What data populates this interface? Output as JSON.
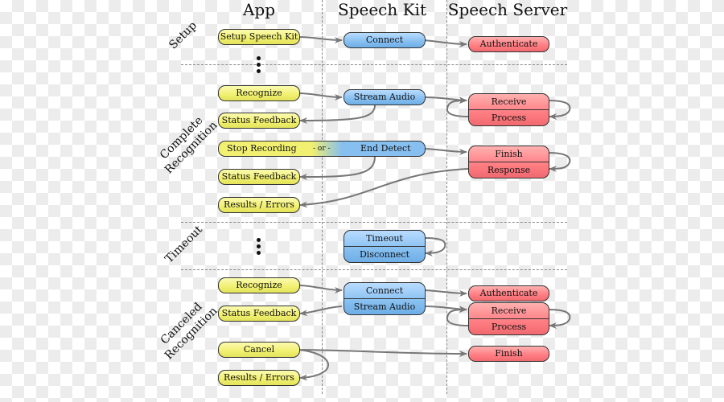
{
  "columns": {
    "app": "App",
    "speech_kit": "Speech Kit",
    "speech_server": "Speech Server"
  },
  "sections": {
    "setup": "Setup",
    "complete": [
      "Complete",
      "Recognition"
    ],
    "timeout": "Timeout",
    "canceled": [
      "Canceled",
      "Recognition"
    ]
  },
  "setup": {
    "app": "Setup Speech Kit",
    "kit": "Connect",
    "server": "Authenticate"
  },
  "complete": {
    "recognize": "Recognize",
    "stream_audio": "Stream Audio",
    "receive": "Receive",
    "process": "Process",
    "status_feedback_1": "Status Feedback",
    "stop_recording": "Stop Recording",
    "or": "- or -",
    "end_detect": "End Detect",
    "finish": "Finish",
    "response": "Response",
    "status_feedback_2": "Status Feedback",
    "results": "Results / Errors"
  },
  "timeout": {
    "timeout": "Timeout",
    "disconnect": "Disconnect"
  },
  "canceled": {
    "recognize": "Recognize",
    "connect": "Connect",
    "stream_audio": "Stream Audio",
    "authenticate": "Authenticate",
    "receive": "Receive",
    "process": "Process",
    "status_feedback": "Status Feedback",
    "cancel": "Cancel",
    "finish": "Finish",
    "results": "Results / Errors"
  },
  "colors": {
    "app": "#f1f070",
    "speech_kit": "#86bff0",
    "speech_server": "#ff7d82",
    "arrow": "#777777"
  }
}
